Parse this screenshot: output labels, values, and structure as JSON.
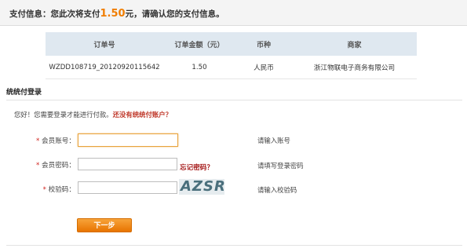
{
  "header": {
    "prefix": "支付信息：您此次将支付",
    "amount": "1.50",
    "suffix": "元，请确认您的支付信息。"
  },
  "order_table": {
    "columns": [
      "订单号",
      "订单金额（元）",
      "币种",
      "商家"
    ],
    "row": [
      "WZDD108719_20120920115642",
      "1.50",
      "人民币",
      "浙江物联电子商务有限公司"
    ]
  },
  "login": {
    "section_title": "统统付登录",
    "greeting_prefix": "您好！您需要登录才能进行付款。",
    "register_link": "还没有统统付账户？",
    "required_mark": "*",
    "account": {
      "label": "会员账号：",
      "value": "",
      "hint": "请输入账号"
    },
    "password": {
      "label": "会员密码：",
      "value": "",
      "hint": "请填写登录密码",
      "forgot": "忘记密码？"
    },
    "captcha": {
      "label": "校验码：",
      "value": "",
      "image_text": "AZSR",
      "hint": "请输入校验码"
    },
    "next_button": "下一步"
  },
  "colors": {
    "amount": "#f07d00",
    "button": "#f08a11",
    "link": "#c0392b"
  }
}
